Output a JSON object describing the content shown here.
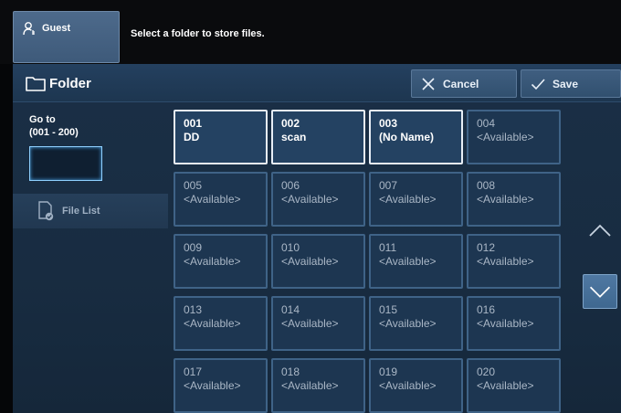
{
  "topbar": {
    "user_label": "Guest",
    "user_icon": "user-key-icon",
    "prompt": "Select a folder to store files."
  },
  "header": {
    "title": "Folder",
    "icon": "folder-icon",
    "cancel_label": "Cancel",
    "save_label": "Save"
  },
  "sidebar": {
    "goto_label_line1": "Go to",
    "goto_label_line2": "(001 - 200)",
    "goto_value": "",
    "file_list_label": "File List"
  },
  "folders": [
    {
      "num": "001",
      "name": "DD",
      "used": true
    },
    {
      "num": "002",
      "name": "scan",
      "used": true
    },
    {
      "num": "003",
      "name": "(No Name)",
      "used": true
    },
    {
      "num": "004",
      "name": "<Available>",
      "used": false
    },
    {
      "num": "005",
      "name": "<Available>",
      "used": false
    },
    {
      "num": "006",
      "name": "<Available>",
      "used": false
    },
    {
      "num": "007",
      "name": "<Available>",
      "used": false
    },
    {
      "num": "008",
      "name": "<Available>",
      "used": false
    },
    {
      "num": "009",
      "name": "<Available>",
      "used": false
    },
    {
      "num": "010",
      "name": "<Available>",
      "used": false
    },
    {
      "num": "011",
      "name": "<Available>",
      "used": false
    },
    {
      "num": "012",
      "name": "<Available>",
      "used": false
    },
    {
      "num": "013",
      "name": "<Available>",
      "used": false
    },
    {
      "num": "014",
      "name": "<Available>",
      "used": false
    },
    {
      "num": "015",
      "name": "<Available>",
      "used": false
    },
    {
      "num": "016",
      "name": "<Available>",
      "used": false
    },
    {
      "num": "017",
      "name": "<Available>",
      "used": false
    },
    {
      "num": "018",
      "name": "<Available>",
      "used": false
    },
    {
      "num": "019",
      "name": "<Available>",
      "used": false
    },
    {
      "num": "020",
      "name": "<Available>",
      "used": false
    }
  ],
  "colors": {
    "accent": "#3f6890",
    "panel": "#1a2f46",
    "selected_border": "#e7eef6"
  }
}
